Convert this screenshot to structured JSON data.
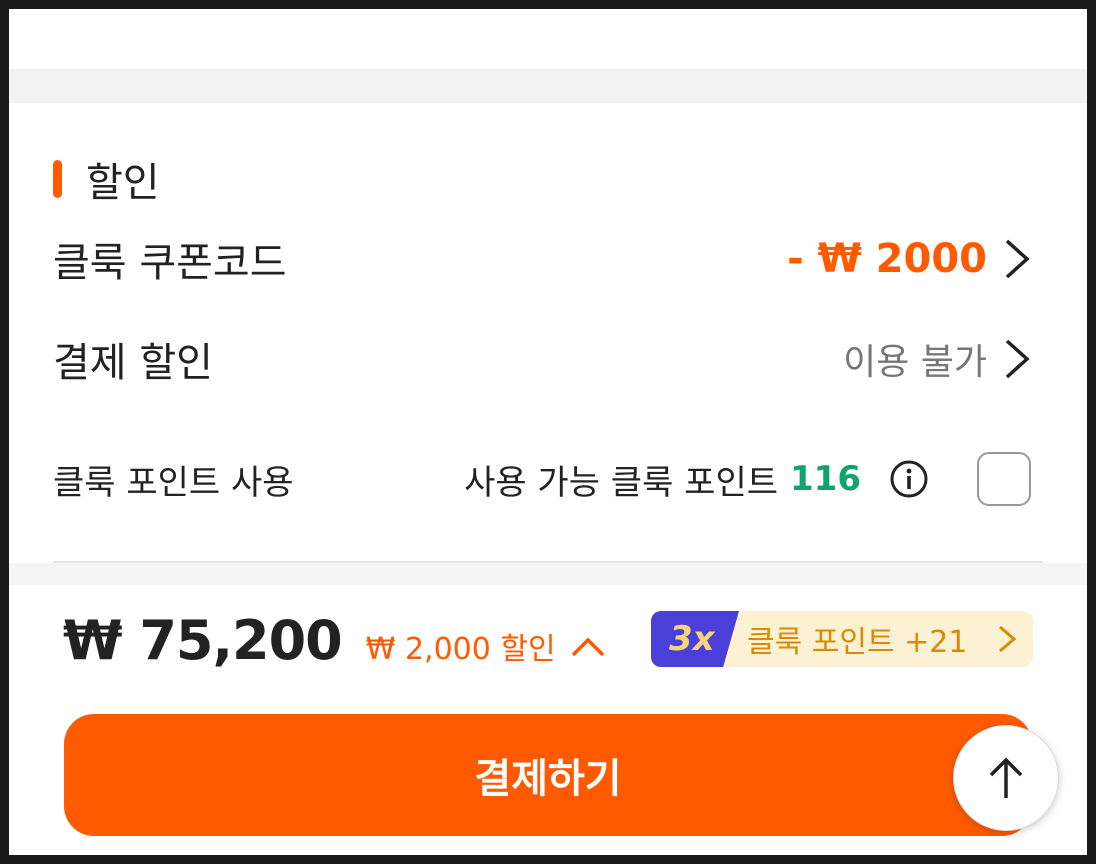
{
  "section": {
    "title": "할인"
  },
  "coupon": {
    "label": "클룩 쿠폰코드",
    "value": "- ₩ 2000"
  },
  "payment_discount": {
    "label": "결제 할인",
    "value": "이용 불가"
  },
  "points": {
    "label": "클룩 포인트 사용",
    "available_text": "사용 가능 클룩 포인트",
    "available_value": "116"
  },
  "summary": {
    "total": "₩ 75,200",
    "discount": "₩ 2,000 할인"
  },
  "badge": {
    "multiplier": "3x",
    "text": "클룩 포인트 +21"
  },
  "pay_button": {
    "label": "결제하기"
  },
  "colors": {
    "accent": "#ff5a00",
    "points_green": "#10a36b",
    "badge_purple": "#4b3fd9",
    "badge_bg": "#fdf1d4"
  }
}
